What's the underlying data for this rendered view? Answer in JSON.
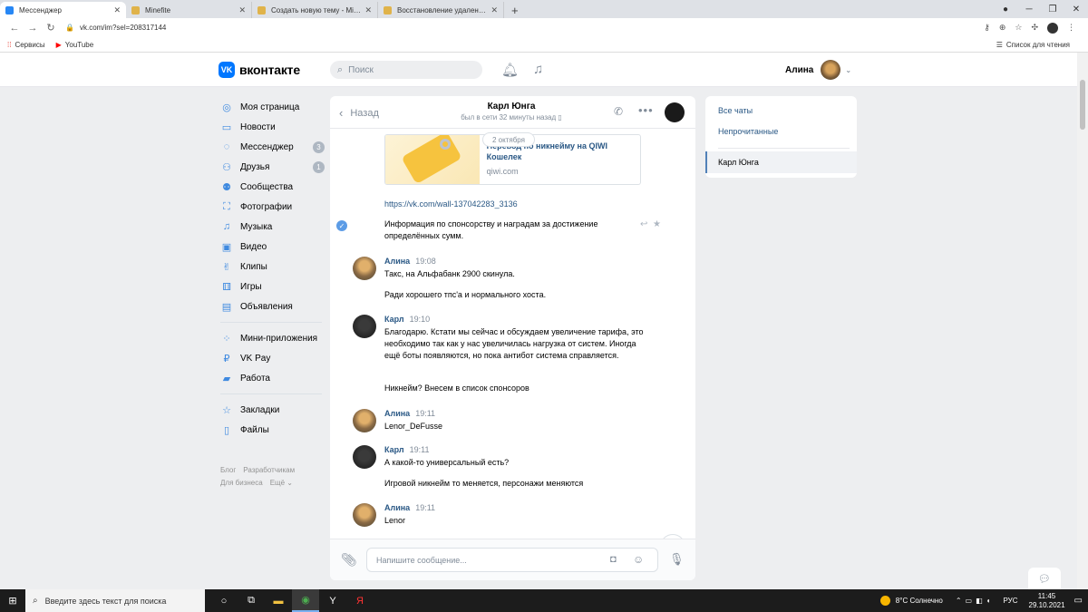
{
  "browser": {
    "tabs": [
      {
        "label": "Мессенджер",
        "color": "#2787f5",
        "active": true
      },
      {
        "label": "Minefite",
        "color": "#e0b34a",
        "active": false
      },
      {
        "label": "Создать новую тему - Minefite",
        "color": "#e0b34a",
        "active": false
      },
      {
        "label": "Восстановление удаленных сис",
        "color": "#e0b34a",
        "active": false
      }
    ],
    "close_glyph": "✕",
    "new_tab": "+",
    "url": "vk.com/im?sel=208317144",
    "bookmarks": [
      {
        "label": "Сервисы"
      },
      {
        "label": "YouTube"
      }
    ],
    "reading_list": "Список для чтения"
  },
  "vk": {
    "logo_text": "вконтакте",
    "search_placeholder": "Поиск",
    "user_name": "Алина"
  },
  "nav": {
    "items": [
      {
        "label": "Моя страница",
        "badge": ""
      },
      {
        "label": "Новости",
        "badge": ""
      },
      {
        "label": "Мессенджер",
        "badge": "3"
      },
      {
        "label": "Друзья",
        "badge": "1"
      },
      {
        "label": "Сообщества",
        "badge": ""
      },
      {
        "label": "Фотографии",
        "badge": ""
      },
      {
        "label": "Музыка",
        "badge": ""
      },
      {
        "label": "Видео",
        "badge": ""
      },
      {
        "label": "Клипы",
        "badge": ""
      },
      {
        "label": "Игры",
        "badge": ""
      },
      {
        "label": "Объявления",
        "badge": ""
      }
    ],
    "items2": [
      {
        "label": "Мини-приложения"
      },
      {
        "label": "VK Pay"
      },
      {
        "label": "Работа"
      }
    ],
    "items3": [
      {
        "label": "Закладки"
      },
      {
        "label": "Файлы"
      }
    ],
    "footer": [
      "Блог",
      "Разработчикам",
      "Для бизнеса",
      "Ещё ⌄"
    ]
  },
  "chat": {
    "back_label": "Назад",
    "title": "Карл Юнга",
    "status": "был в сети 32 минуты назад",
    "date_pill": "2 октября",
    "link_title": "Перевод по никнейму на QIWI Кошелек",
    "link_domain": "qiwi.com",
    "link_url": "https://vk.com/wall-137042283_3136",
    "first_message": "Информация по спонсорству и наградам за достижение определённых сумм.",
    "messages": [
      {
        "author": "Алина",
        "time": "19:08",
        "lines": [
          "Такс, на Альфабанк 2900 скинула.",
          "Ради хорошего тпс'а и нормального хоста."
        ]
      },
      {
        "author": "Карл",
        "time": "19:10",
        "lines": [
          "Благодарю. Кстати мы сейчас и обсуждаем увеличение тарифа, это необходимо так как у нас увеличилась нагрузка от систем. Иногда ещё боты появляются, но пока антибот система справляется.",
          "Никнейм? Внесем в список спонсоров"
        ]
      },
      {
        "author": "Алина",
        "time": "19:11",
        "lines": [
          "Lenor_DeFusse"
        ]
      },
      {
        "author": "Карл",
        "time": "19:11",
        "lines": [
          "А какой-то универсальный есть?",
          "Игровой никнейм то меняется, персонажи меняются"
        ]
      },
      {
        "author": "Алина",
        "time": "19:11",
        "lines": [
          "Lenor"
        ]
      }
    ],
    "compose_placeholder": "Напишите сообщение..."
  },
  "right_panel": {
    "all_chats": "Все чаты",
    "unread": "Непрочитанные",
    "active_chat": "Карл Юнга"
  },
  "taskbar": {
    "search_placeholder": "Введите здесь текст для поиска",
    "weather": "8°C Солнечно",
    "lang": "РУС",
    "time": "11:45",
    "date": "29.10.2021"
  }
}
